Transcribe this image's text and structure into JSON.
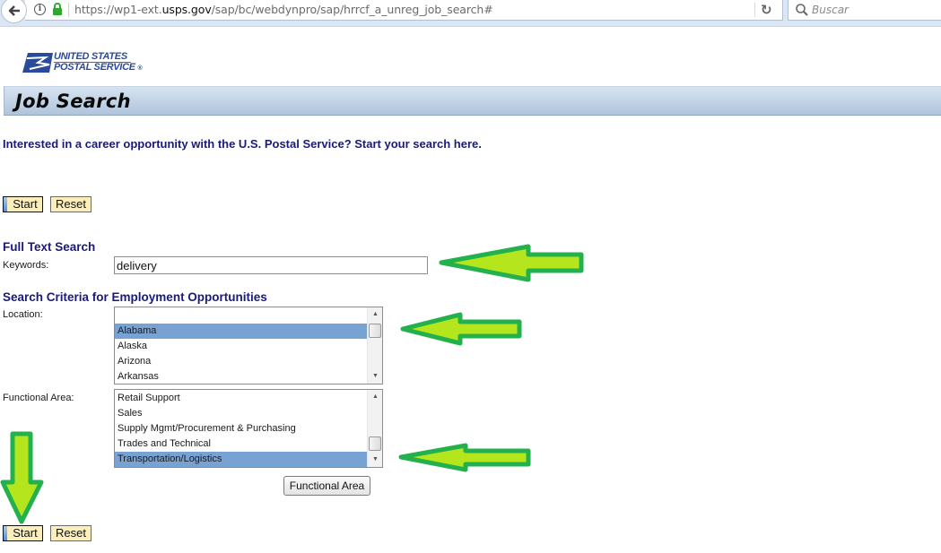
{
  "browser": {
    "url_prefix": "https://wp1-ext.",
    "url_domain": "usps.gov",
    "url_path": "/sap/bc/webdynpro/sap/hrrcf_a_unreg_job_search#",
    "search_placeholder": "Buscar",
    "icons": [
      "back-arrow-icon",
      "info-icon",
      "lock-icon",
      "reload-icon",
      "search-icon"
    ]
  },
  "logo": {
    "line1": "UNITED STATES",
    "line2": "POSTAL SERVICE",
    "reg": "®"
  },
  "header": {
    "title": "Job Search"
  },
  "intro_text": "Interested in a career opportunity with the U.S. Postal Service? Start your search here.",
  "top_buttons": {
    "start": "Start",
    "reset": "Reset"
  },
  "full_text_search": {
    "heading": "Full Text Search",
    "keywords_label": "Keywords:",
    "keywords_value": "delivery"
  },
  "criteria": {
    "heading": "Search Criteria for Employment Opportunities",
    "location": {
      "label": "Location:",
      "options": [
        "",
        "Alabama",
        "Alaska",
        "Arizona",
        "Arkansas"
      ],
      "selected": "Alabama"
    },
    "functional_area": {
      "label": "Functional Area:",
      "options": [
        "Retail Support",
        "Sales",
        "Supply Mgmt/Procurement & Purchasing",
        "Trades and Technical",
        "Transportation/Logistics"
      ],
      "selected": "Transportation/Logistics",
      "button": "Functional Area"
    }
  },
  "bottom_buttons": {
    "start": "Start",
    "reset": "Reset"
  },
  "annotations": {
    "arrow_color_fill": "#b5e61d",
    "arrow_color_stroke": "#22b14c"
  }
}
